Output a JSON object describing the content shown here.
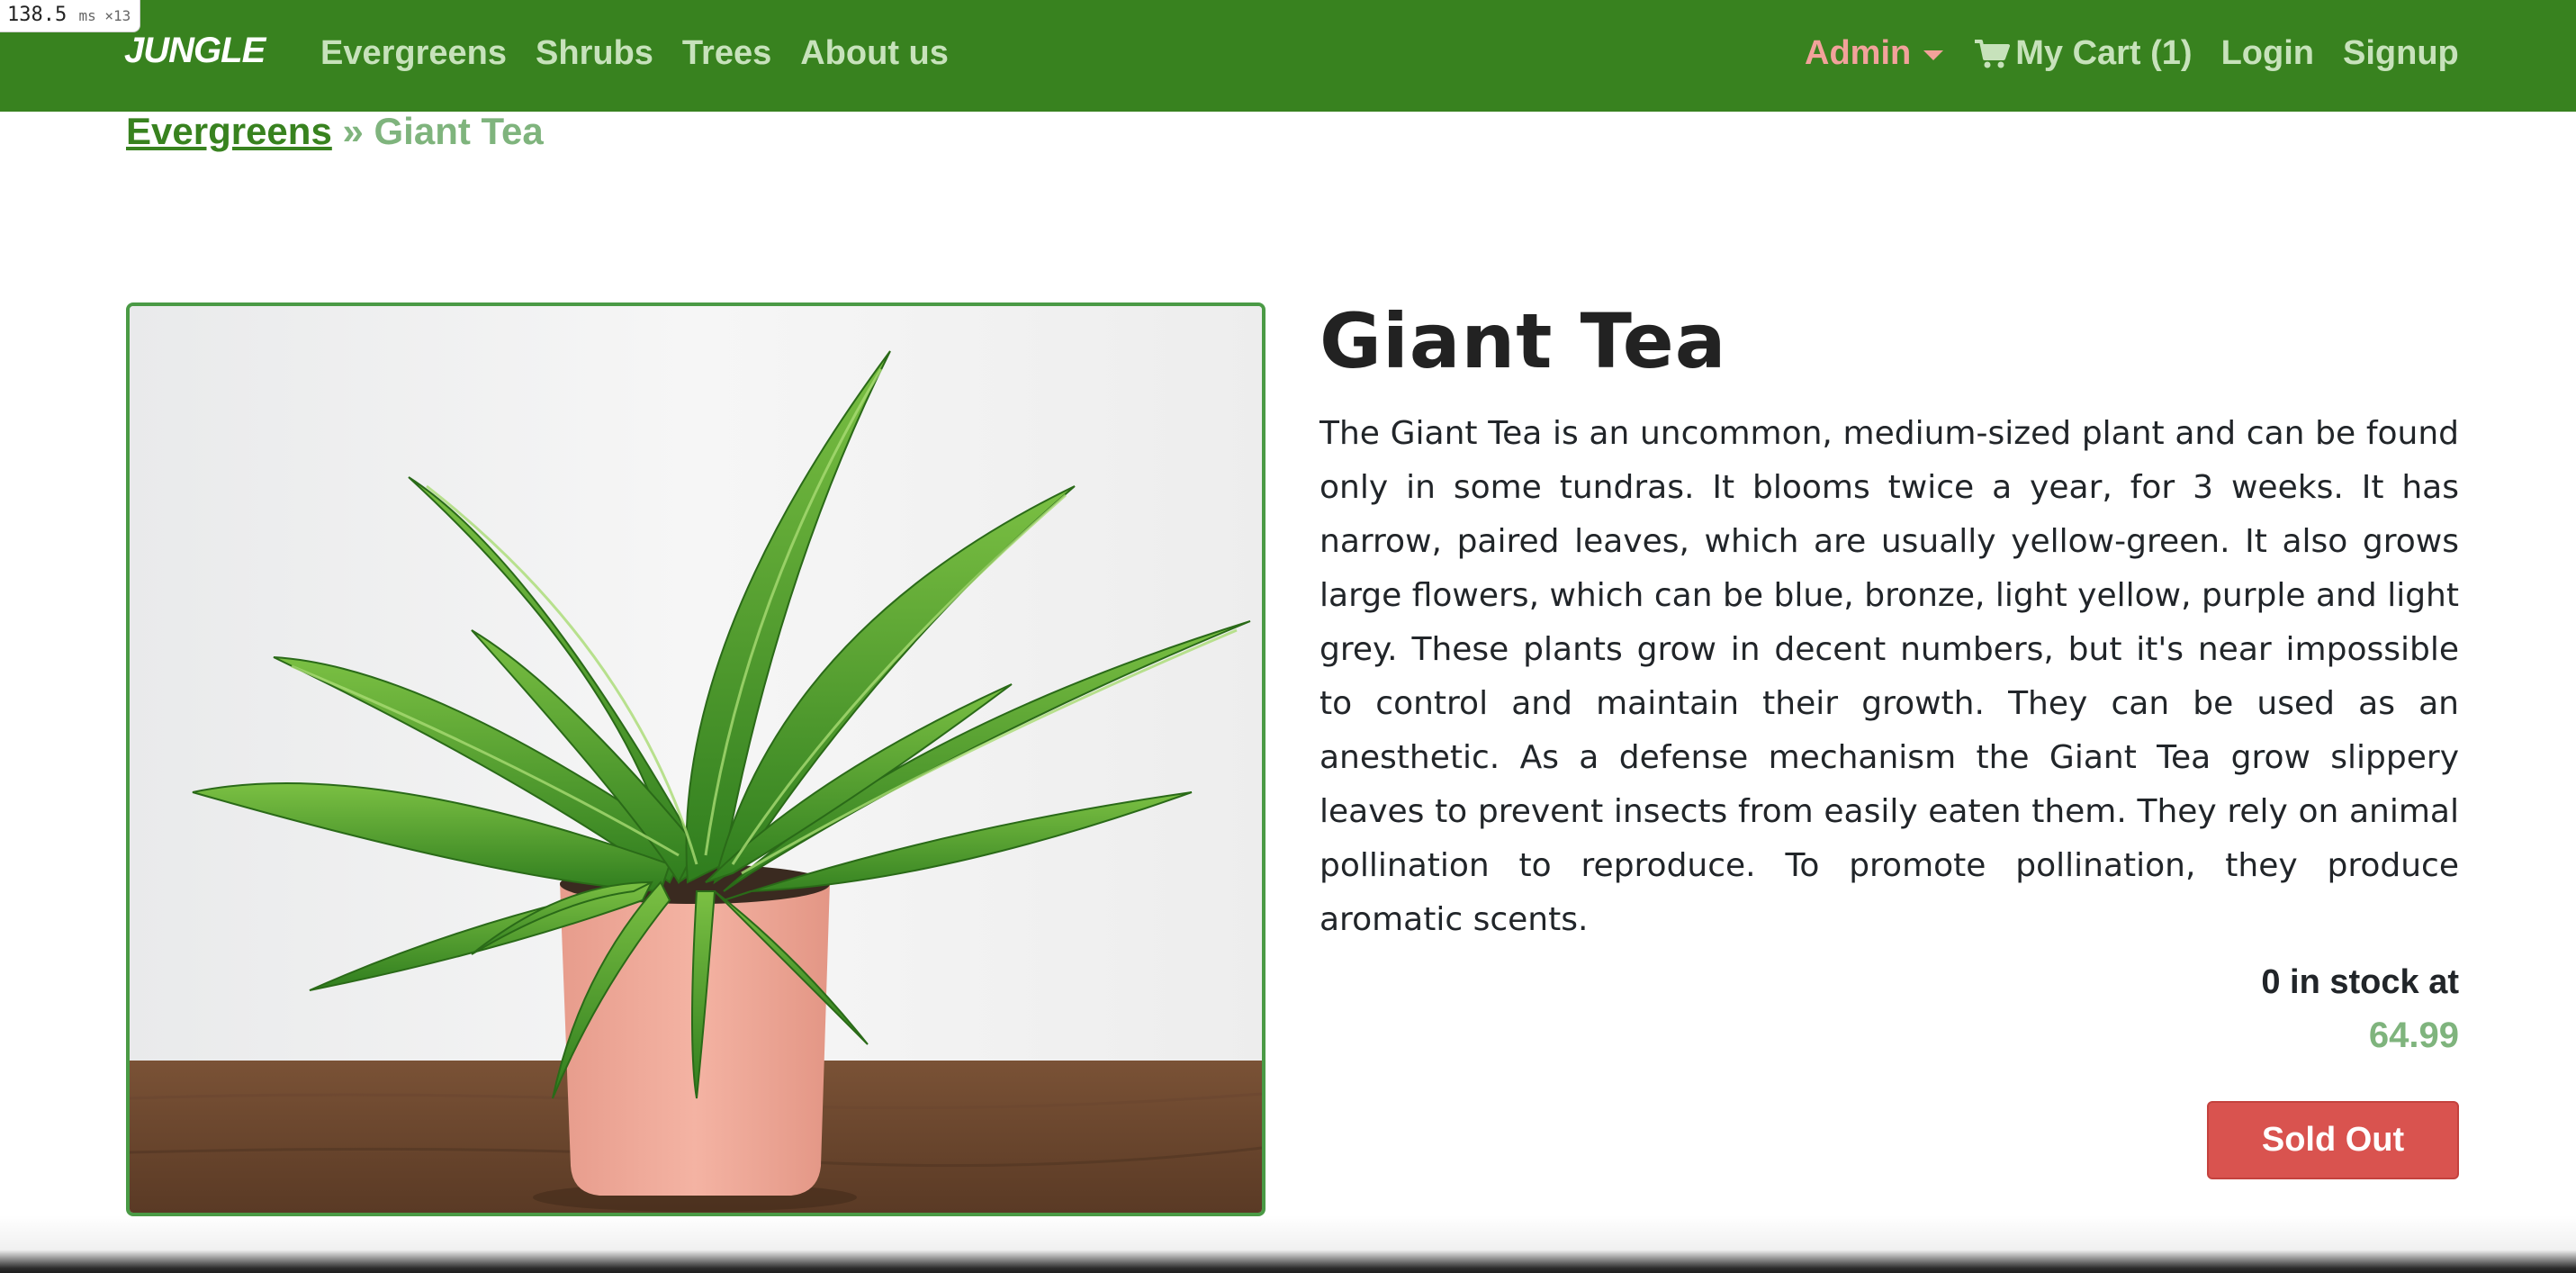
{
  "perf_badge": {
    "value": "138.5",
    "unit": "ms ×13"
  },
  "navbar": {
    "brand": "JUNGLE",
    "links": [
      "Evergreens",
      "Shrubs",
      "Trees",
      "About us"
    ],
    "admin": "Admin",
    "cart": "My Cart (1)",
    "login": "Login",
    "signup": "Signup",
    "colors": {
      "background": "#38821f",
      "link": "#c7e2bb",
      "admin": "#f2a29b"
    }
  },
  "breadcrumb": {
    "parent": "Evergreens",
    "separator": "»",
    "current": "Giant Tea"
  },
  "product": {
    "image_icon": "potted-fern-image",
    "title": "Giant Tea",
    "description": "The Giant Tea is an uncommon, medium-sized plant and can be found only in some tundras. It blooms twice a year, for 3 weeks. It has narrow, paired leaves, which are usually yellow-green. It also grows large flowers, which can be blue, bronze, light yellow, purple and light grey. These plants grow in decent numbers, but it's near impossible to control and maintain their growth. They can be used as an anesthetic. As a defense mechanism the Giant Tea grow slippery leaves to prevent insects from easily eaten them. They rely on animal pollination to reproduce. To promote pollination, they produce aromatic scents.",
    "stock_text": "0 in stock at",
    "price": "64.99",
    "button_label": "Sold Out",
    "colors": {
      "button": "#d9534f",
      "price": "#7fb47d"
    }
  }
}
